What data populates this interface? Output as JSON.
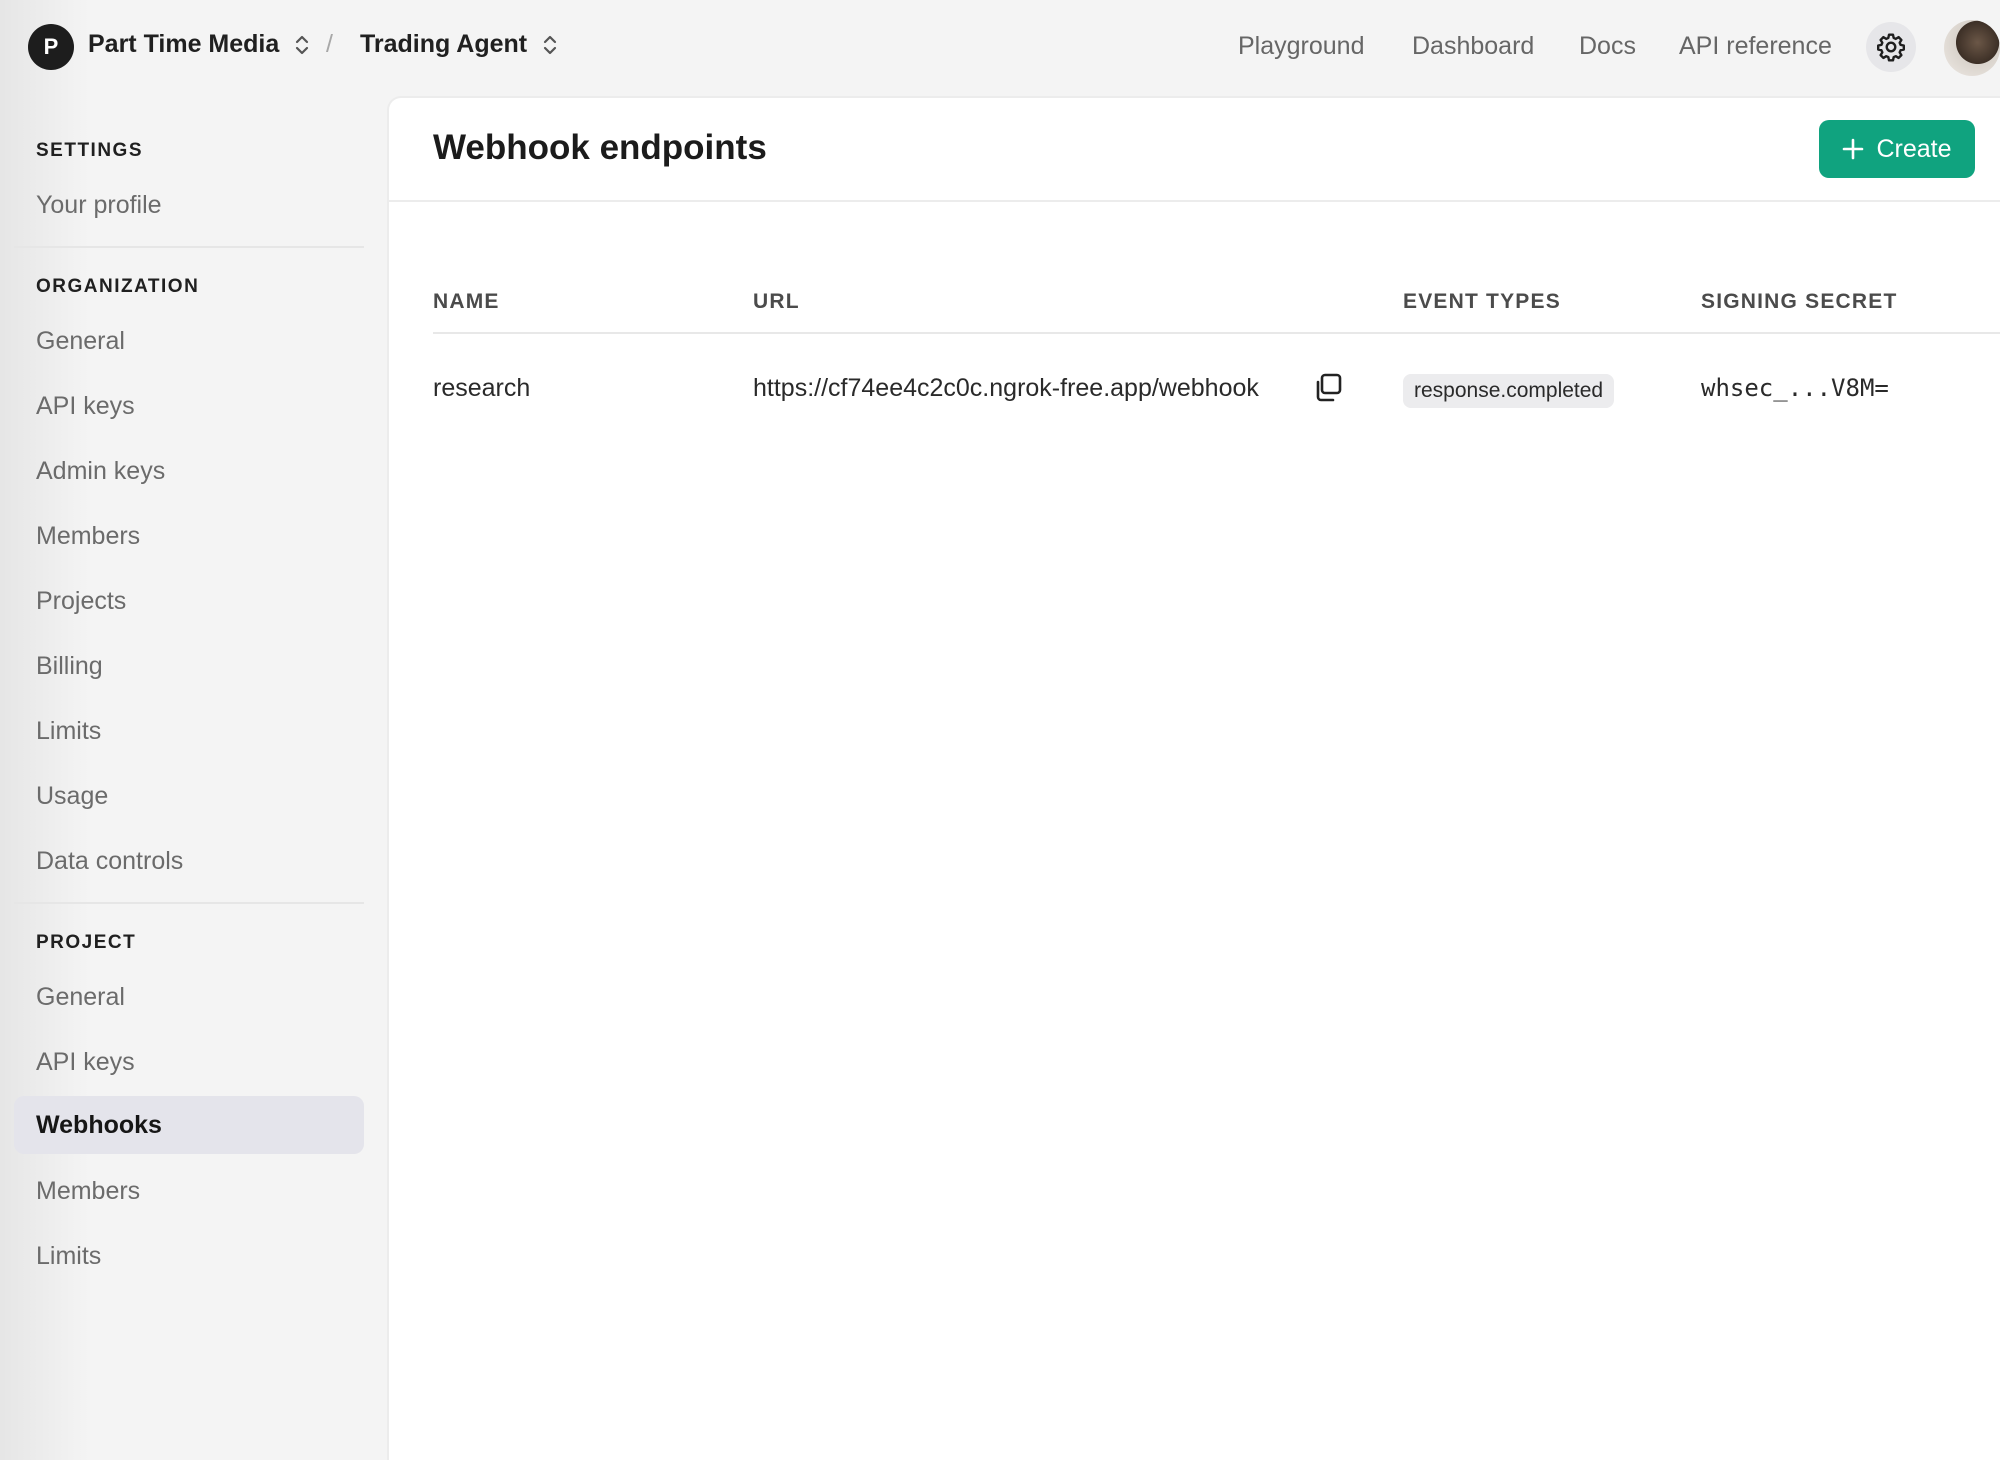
{
  "topbar": {
    "org_initial": "P",
    "org_name": "Part Time Media",
    "separator": "/",
    "project_name": "Trading Agent",
    "nav": [
      "Playground",
      "Dashboard",
      "Docs",
      "API reference"
    ]
  },
  "sidebar": {
    "settings": {
      "title": "SETTINGS",
      "items": [
        "Your profile"
      ]
    },
    "organization": {
      "title": "ORGANIZATION",
      "items": [
        "General",
        "API keys",
        "Admin keys",
        "Members",
        "Projects",
        "Billing",
        "Limits",
        "Usage",
        "Data controls"
      ]
    },
    "project": {
      "title": "PROJECT",
      "items": [
        "General",
        "API keys",
        "Webhooks",
        "Members",
        "Limits"
      ],
      "active": "Webhooks"
    }
  },
  "main": {
    "title": "Webhook endpoints",
    "create_label": "Create",
    "accent": "#10a37f",
    "table": {
      "headers": [
        "NAME",
        "URL",
        "EVENT TYPES",
        "SIGNING SECRET"
      ],
      "rows": [
        {
          "name": "research",
          "url": "https://cf74ee4c2c0c.ngrok-free.app/webhook",
          "event_type": "response.completed",
          "secret": "whsec_...V8M="
        }
      ]
    }
  }
}
